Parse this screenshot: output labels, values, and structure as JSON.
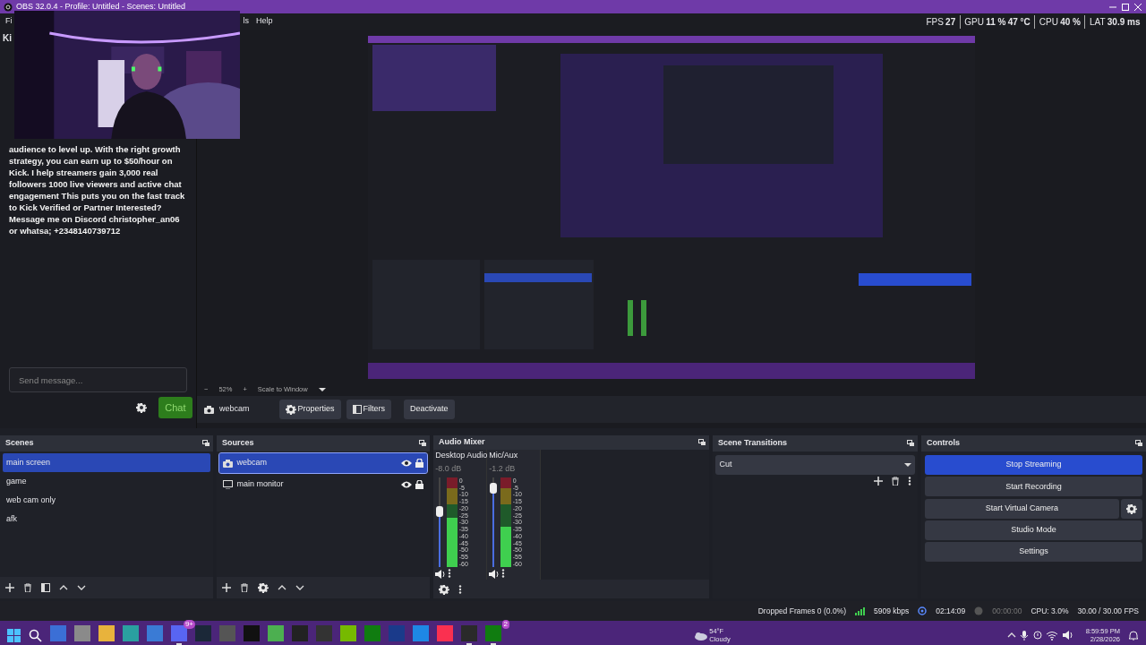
{
  "window": {
    "title": "OBS 32.0.4 - Profile: Untitled - Scenes: Untitled"
  },
  "menu": [
    "Fi",
    "ls",
    "Help"
  ],
  "stats": [
    {
      "label": "FPS",
      "values": [
        "27"
      ]
    },
    {
      "label": "GPU",
      "values": [
        "11 %",
        "47 °C"
      ]
    },
    {
      "label": "CPU",
      "values": [
        "40 %"
      ]
    },
    {
      "label": "LAT",
      "values": [
        "30.9 ms"
      ]
    }
  ],
  "chat": {
    "tab": "Ki",
    "message": "audience to level up. With the right growth strategy, you can earn up to $50/hour on Kick. I help streamers gain 3,000 real followers 1000 live viewers and active chat engagement This puts you on the fast track to Kick Verified or Partner Interested? Message me on Discord christopher_an06 or whatsa; +2348140739712",
    "input": {
      "placeholder": "Send message..."
    },
    "send_button": "Chat"
  },
  "zoom_bar": {
    "minus": "−",
    "zoom": "52%",
    "plus": "+",
    "scale": "Scale to Window"
  },
  "source_toolbar": {
    "source": "webcam",
    "buttons": [
      "Properties",
      "Filters",
      "Deactivate"
    ]
  },
  "scenes": {
    "title": "Scenes",
    "items": [
      {
        "label": "main screen",
        "selected": true
      },
      {
        "label": "game",
        "selected": false
      },
      {
        "label": "web cam only",
        "selected": false
      },
      {
        "label": "afk",
        "selected": false
      }
    ]
  },
  "sources": {
    "title": "Sources",
    "items": [
      {
        "label": "webcam",
        "kind": "camera",
        "selected": true,
        "visible": true,
        "locked": true
      },
      {
        "label": "main monitor",
        "kind": "display",
        "selected": false,
        "visible": true,
        "locked": true
      }
    ]
  },
  "audio_mixer": {
    "title": "Audio Mixer",
    "channels": [
      {
        "name": "Desktop Audio",
        "reading": "-8.0 dB",
        "level": 0.62,
        "meter": {
          "level": 0.55
        },
        "scale": [
          "0",
          "-5",
          "-10",
          "-15",
          "-20",
          "-25",
          "-30",
          "-35",
          "-40",
          "-45",
          "-50",
          "-55",
          "-60"
        ]
      },
      {
        "name": "Mic/Aux",
        "reading": "-1.2 dB",
        "level": 0.88,
        "meter": {
          "level": 0.45
        },
        "scale": [
          "0",
          "-5",
          "-10",
          "-15",
          "-20",
          "-25",
          "-30",
          "-35",
          "-40",
          "-45",
          "-50",
          "-55",
          "-60"
        ]
      }
    ]
  },
  "scene_transitions": {
    "title": "Scene Transitions",
    "transition": "Cut"
  },
  "controls": {
    "title": "Controls",
    "buttons": [
      {
        "label": "Stop Streaming",
        "active": true,
        "kind": "plain"
      },
      {
        "label": "Start Recording",
        "active": false,
        "kind": "plain"
      },
      {
        "label": "Start Virtual Camera",
        "active": false,
        "kind": "with-settings"
      },
      {
        "label": "Studio Mode",
        "active": false,
        "kind": "plain"
      },
      {
        "label": "Settings",
        "active": false,
        "kind": "plain"
      }
    ]
  },
  "status_bar": {
    "dropped": "Dropped Frames 0 (0.0%)",
    "bitrate": "5909 kbps",
    "stream_time": "02:14:09",
    "record_time": "00:00:00",
    "cpu": "CPU: 3.0%",
    "fps": "30.00 / 30.00 FPS"
  },
  "taskbar": {
    "apps": [
      {
        "color": "#3b6fd6",
        "open": false
      },
      {
        "color": "#8a8a8a",
        "open": false
      },
      {
        "color": "#e8b33c",
        "open": false
      },
      {
        "color": "#2aa0a0",
        "open": false
      },
      {
        "color": "#3a7bd5",
        "open": false
      },
      {
        "color": "#5865f2",
        "open": true,
        "badge": "9+"
      },
      {
        "color": "#1b2838",
        "open": false
      },
      {
        "color": "#555555",
        "open": false
      },
      {
        "color": "#111111",
        "open": false
      },
      {
        "color": "#4caf50",
        "open": false
      },
      {
        "color": "#222222",
        "open": false
      },
      {
        "color": "#333333",
        "open": false
      },
      {
        "color": "#76b900",
        "open": false
      },
      {
        "color": "#107c10",
        "open": false
      },
      {
        "color": "#1a3a8a",
        "open": false
      },
      {
        "color": "#1e88e5",
        "open": false
      },
      {
        "color": "#fa3050",
        "open": false
      },
      {
        "color": "#2a2a2a",
        "open": true
      },
      {
        "color": "#107c10",
        "open": true,
        "badge": "2"
      }
    ],
    "weather": {
      "temperature": "54°F",
      "condition": "Cloudy"
    },
    "time": "8:59:59 PM",
    "date": "2/28/2026"
  }
}
